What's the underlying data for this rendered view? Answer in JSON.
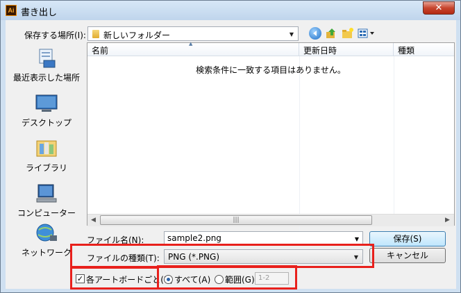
{
  "window": {
    "title": "書き出し",
    "app_icon_text": "Ai",
    "close_glyph": "✕"
  },
  "save_location": {
    "label": "保存する場所(I):",
    "value": "新しいフォルダー"
  },
  "places": [
    {
      "label": "最近表示した場所",
      "icon": "recent-places-icon"
    },
    {
      "label": "デスクトップ",
      "icon": "desktop-icon"
    },
    {
      "label": "ライブラリ",
      "icon": "libraries-icon"
    },
    {
      "label": "コンピューター",
      "icon": "computer-icon"
    },
    {
      "label": "ネットワーク",
      "icon": "network-icon"
    }
  ],
  "file_list": {
    "columns": [
      "名前",
      "更新日時",
      "種類"
    ],
    "empty_message": "検索条件に一致する項目はありません。",
    "sort_glyph": "▲",
    "scroll_grip": "|||"
  },
  "file_name": {
    "label": "ファイル名(N):",
    "value": "sample2.png"
  },
  "file_type": {
    "label": "ファイルの種類(T):",
    "value": "PNG (*.PNG)"
  },
  "buttons": {
    "save": "保存(S)",
    "cancel": "キャンセル"
  },
  "artboard": {
    "checkbox_label": "各アートボードごと(U)",
    "checked": true,
    "check_glyph": "✓"
  },
  "range": {
    "all_label": "すべて(A)",
    "range_label": "範囲(G)",
    "range_value": "1-2"
  },
  "colors": {
    "highlight": "#e8201c",
    "title_bar": "#c9dcf0"
  }
}
